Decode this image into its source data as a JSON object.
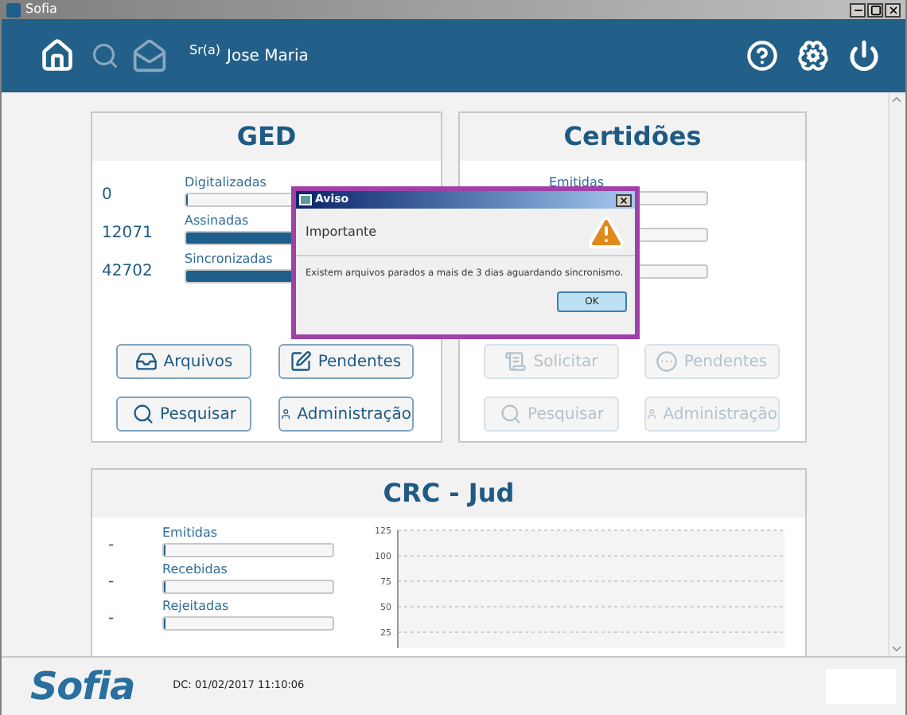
{
  "window": {
    "title": "Sofia"
  },
  "header": {
    "salutation": "Sr(a)",
    "user": "Jose Maria"
  },
  "ged": {
    "title": "GED",
    "rows": [
      {
        "value": "0",
        "label": "Digitalizadas",
        "level": 0
      },
      {
        "value": "12071",
        "label": "Assinadas",
        "level": 1
      },
      {
        "value": "42702",
        "label": "Sincronizadas",
        "level": 1
      }
    ],
    "buttons": [
      {
        "label": "Arquivos",
        "disabled": false
      },
      {
        "label": "Pendentes",
        "disabled": false
      },
      {
        "label": "Pesquisar",
        "disabled": false
      },
      {
        "label": "Administração",
        "disabled": false
      }
    ]
  },
  "certidoes": {
    "title": "Certidões",
    "rows": [
      {
        "label": "Emitidas",
        "level": 0
      },
      {
        "level": 0
      },
      {
        "level": 0
      }
    ],
    "buttons": [
      {
        "label": "Solicitar",
        "disabled": true
      },
      {
        "label": "Pendentes",
        "disabled": true
      },
      {
        "label": "Pesquisar",
        "disabled": true
      },
      {
        "label": "Administração",
        "disabled": true
      }
    ]
  },
  "crc": {
    "title": "CRC - Jud",
    "rows": [
      {
        "value": "-",
        "label": "Emitidas",
        "level": 0
      },
      {
        "value": "-",
        "label": "Recebidas",
        "level": 0
      },
      {
        "value": "-",
        "label": "Rejeitadas",
        "level": 0
      }
    ],
    "chart_axis_labels": [
      "125",
      "100",
      "75",
      "50",
      "25"
    ]
  },
  "dialog": {
    "title": "Aviso",
    "heading": "Importante",
    "message": "Existem arquivos parados a mais de 3 dias aguardando sincronismo.",
    "button": "OK"
  },
  "footer": {
    "logo": "Sofia",
    "timestamp": "DC: 01/02/2017 11:10:06"
  }
}
